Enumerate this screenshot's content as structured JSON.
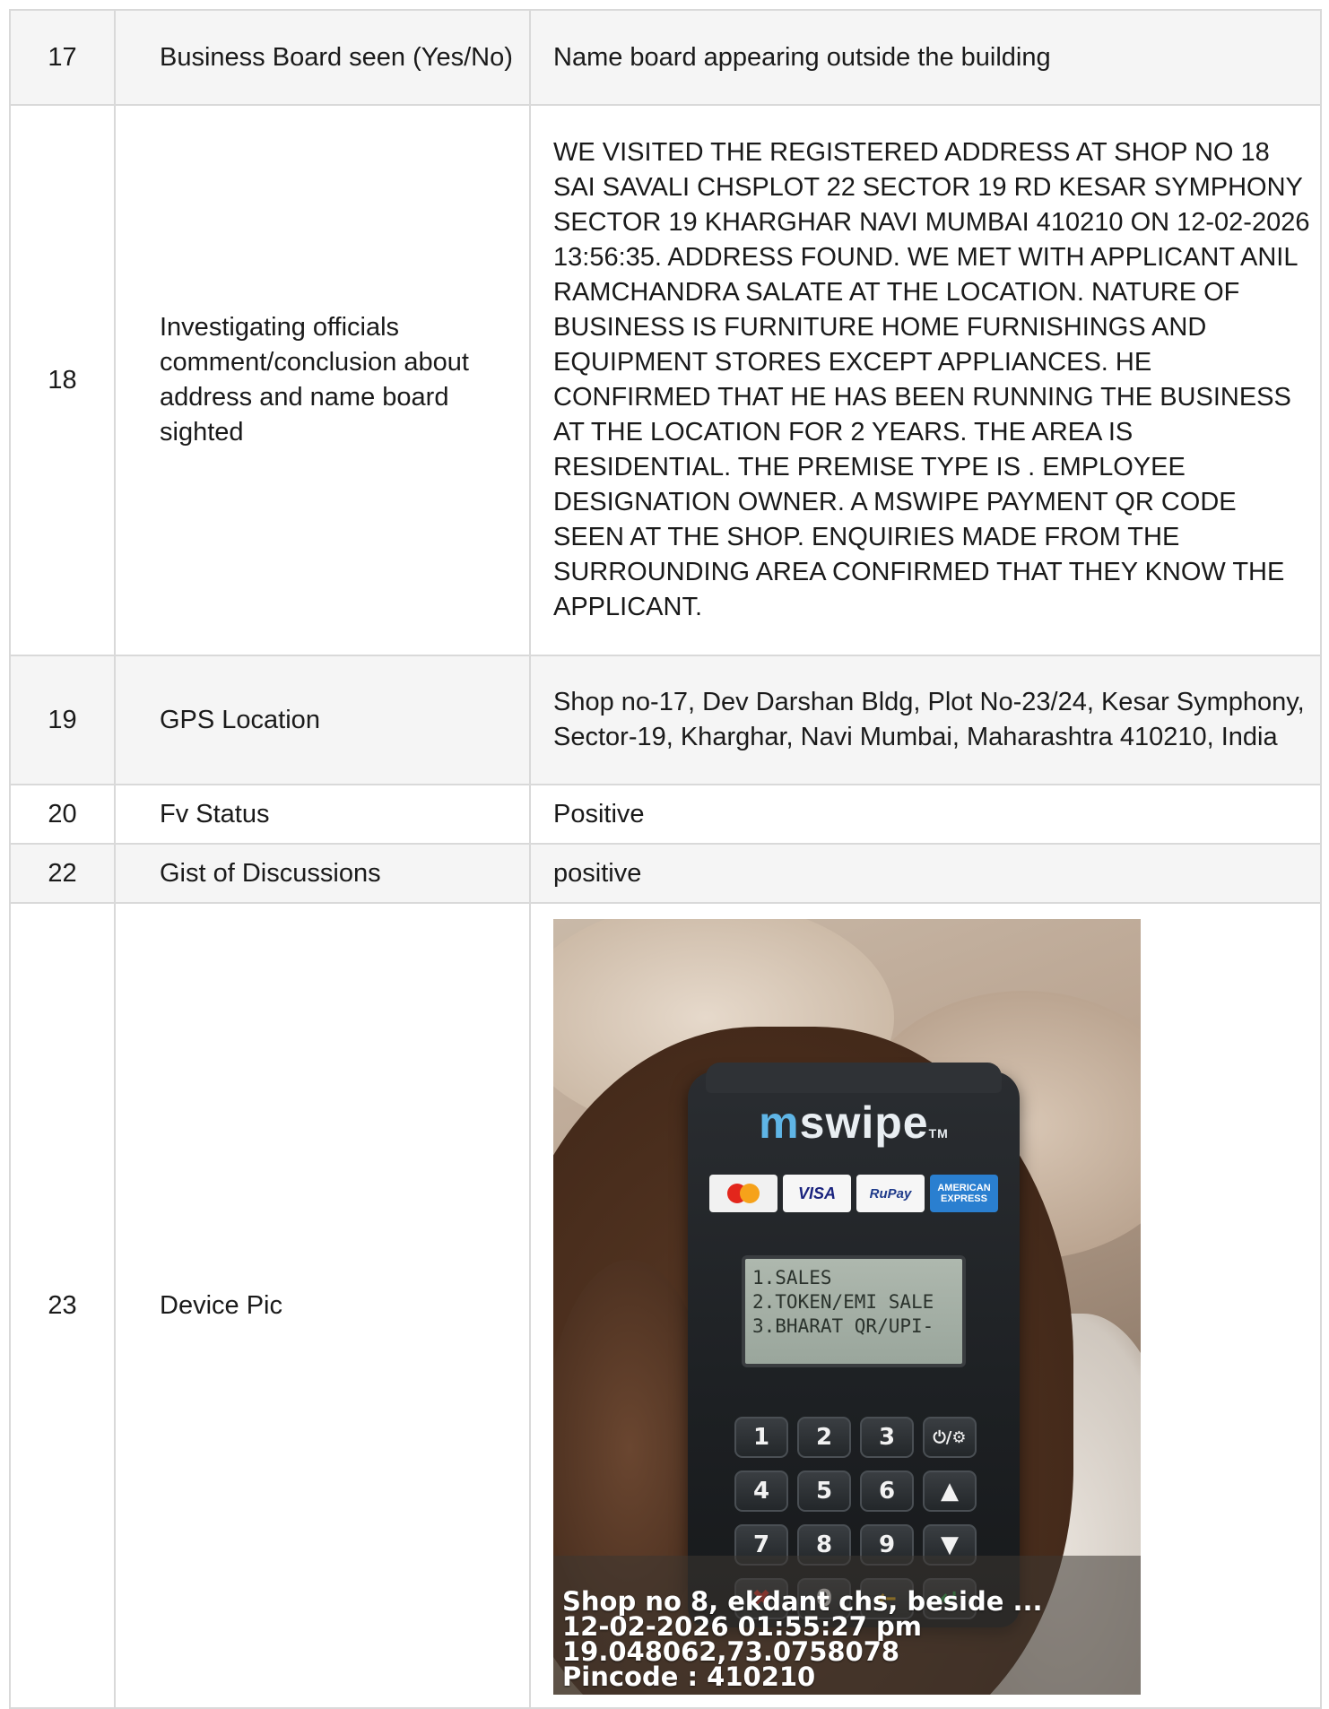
{
  "rows": [
    {
      "no": "17",
      "label": "Business Board seen (Yes/No)",
      "value": "Name board appearing outside the building"
    },
    {
      "no": "18",
      "label": "Investigating officials comment/conclusion about address and name board sighted",
      "value": "WE VISITED THE REGISTERED ADDRESS AT SHOP NO 18 SAI SAVALI CHSPLOT 22 SECTOR 19 RD KESAR SYMPHONY SECTOR 19 KHARGHAR NAVI MUMBAI 410210 ON 12-02-2026 13:56:35. ADDRESS FOUND. WE MET WITH APPLICANT ANIL RAMCHANDRA SALATE AT THE LOCATION. NATURE OF BUSINESS IS FURNITURE HOME FURNISHINGS AND EQUIPMENT STORES EXCEPT APPLIANCES. HE CONFIRMED THAT HE HAS BEEN RUNNING THE BUSINESS AT THE LOCATION FOR 2 YEARS. THE AREA IS RESIDENTIAL. THE PREMISE TYPE IS . EMPLOYEE DESIGNATION OWNER. A MSWIPE PAYMENT QR CODE SEEN AT THE SHOP. ENQUIRIES MADE FROM THE SURROUNDING AREA CONFIRMED THAT THEY KNOW THE APPLICANT."
    },
    {
      "no": "19",
      "label": "GPS Location",
      "value": "Shop no-17, Dev Darshan Bldg, Plot No-23/24, Kesar Symphony, Sector-19, Kharghar, Navi Mumbai, Maharashtra 410210, India"
    },
    {
      "no": "20",
      "label": "Fv Status",
      "value": "Positive"
    },
    {
      "no": "22",
      "label": "Gist of Discussions",
      "value": "positive"
    },
    {
      "no": "23",
      "label": "Device Pic"
    }
  ],
  "photo": {
    "brand_prefix": "m",
    "brand_rest": "swipe",
    "brand_tm": "TM",
    "cards": [
      "mastercard",
      "VISA",
      "RuPay",
      "AMERICAN EXPRESS"
    ],
    "screen_lines": [
      "1.SALES",
      "2.TOKEN/EMI SALE",
      "3.BHARAT QR/UPI-"
    ],
    "keys": [
      "1",
      "2",
      "3",
      "⏻/⚙",
      "4",
      "5",
      "6",
      "▲",
      "7",
      "8",
      "9",
      "▼",
      "✖",
      "0",
      "←",
      "↵"
    ],
    "caption_lines": [
      "Shop no 8, ekdant chs, beside ...",
      "12-02-2026 01:55:27 pm",
      "19.048062,73.0758078",
      "Pincode : 410210"
    ]
  }
}
